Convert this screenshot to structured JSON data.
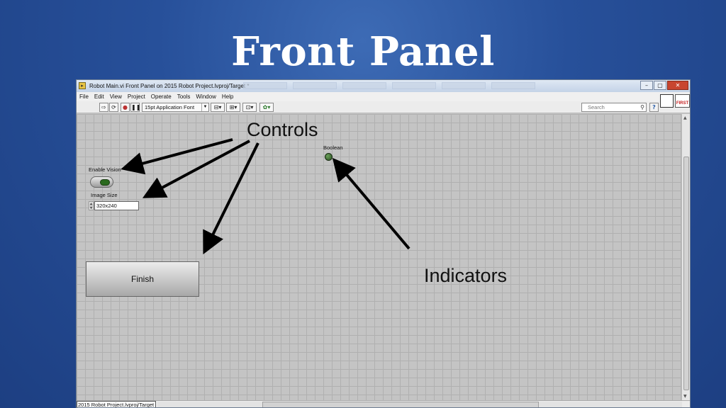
{
  "slide": {
    "title": "Front Panel"
  },
  "window": {
    "title": "Robot Main.vi Front Panel on 2015 Robot Project.lvproj/Target *",
    "controls": {
      "minimize": "–",
      "maximize": "▢",
      "close": "✕"
    }
  },
  "menu": [
    "File",
    "Edit",
    "View",
    "Project",
    "Operate",
    "Tools",
    "Window",
    "Help"
  ],
  "toolbar": {
    "font": "15pt Application Font",
    "search_placeholder": "Search",
    "help": "?",
    "logo": "FIRST"
  },
  "front_panel": {
    "enable_vision": {
      "label": "Enable Vision",
      "value": true
    },
    "image_size": {
      "label": "Image Size",
      "value": "320x240"
    },
    "boolean": {
      "label": "Boolean",
      "value": false
    },
    "finish": {
      "label": "Finish"
    }
  },
  "status": {
    "project": "2015 Robot Project.lvproj/Target"
  },
  "annotations": {
    "controls": "Controls",
    "indicators": "Indicators"
  },
  "colors": {
    "background": "#27509a",
    "canvas": "#c4c4c4",
    "arrow": "#000000"
  }
}
